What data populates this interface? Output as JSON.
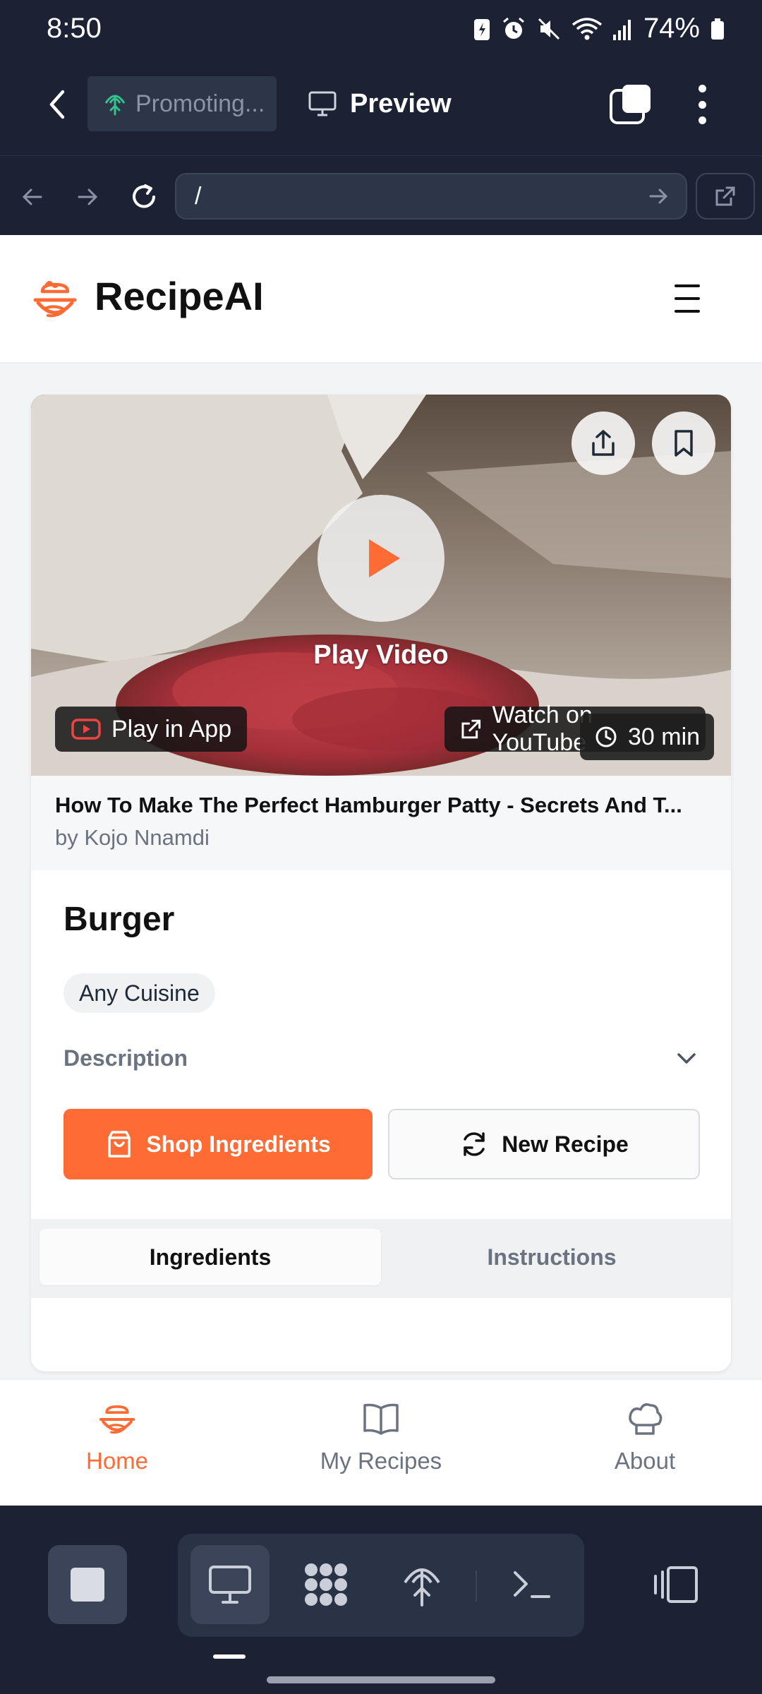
{
  "status_bar": {
    "time": "8:50",
    "battery": "74%"
  },
  "toolbar": {
    "promo_tab": "Promoting...",
    "preview_tab": "Preview"
  },
  "browser": {
    "url": "/"
  },
  "site": {
    "brand": "RecipeAI"
  },
  "video": {
    "play_label": "Play Video",
    "play_in_app": "Play in App",
    "watch_on_youtube": "Watch on YouTube",
    "duration": "30 min",
    "title": "How To Make The Perfect Hamburger Patty - Secrets And T...",
    "author": "by Kojo Nnamdi"
  },
  "recipe": {
    "title": "Burger",
    "cuisine": "Any Cuisine",
    "description_label": "Description",
    "shop_button": "Shop Ingredients",
    "new_recipe_button": "New Recipe",
    "tabs": [
      {
        "label": "Ingredients",
        "active": true
      },
      {
        "label": "Instructions",
        "active": false
      }
    ]
  },
  "bottom_nav": [
    {
      "label": "Home",
      "icon": "chef-bowl-icon",
      "active": true
    },
    {
      "label": "My Recipes",
      "icon": "book-icon",
      "active": false
    },
    {
      "label": "About",
      "icon": "chef-hat-icon",
      "active": false
    }
  ],
  "colors": {
    "accent": "#ff6b35",
    "dark_bar": "#1c2233",
    "page_bg": "#f3f4f6"
  }
}
